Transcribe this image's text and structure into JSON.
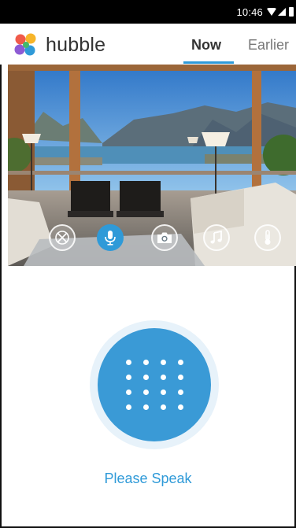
{
  "status_bar": {
    "time": "10:46",
    "icons": [
      "wifi-icon",
      "signal-icon",
      "battery-icon"
    ]
  },
  "header": {
    "brand": "hubble",
    "logo_icon": "hubble-logo",
    "logo_colors": [
      "#f05a4a",
      "#8d5bd4",
      "#f7b52a",
      "#2f9ad8",
      "#43b96b"
    ],
    "tabs": [
      {
        "label": "Now",
        "active": true
      },
      {
        "label": "Earlier",
        "active": false
      }
    ]
  },
  "camera": {
    "controls": [
      {
        "icon": "pan-tilt-icon",
        "active": false
      },
      {
        "icon": "microphone-icon",
        "active": true
      },
      {
        "icon": "camera-snapshot-icon",
        "active": false
      },
      {
        "icon": "music-note-icon",
        "active": false
      },
      {
        "icon": "thermometer-icon",
        "active": false
      }
    ]
  },
  "talk": {
    "icon": "dot-grid-icon",
    "label": "Please Speak"
  },
  "colors": {
    "accent": "#2f9ad8",
    "talk_button": "#3a9ad6",
    "status_bar": "#000000"
  }
}
